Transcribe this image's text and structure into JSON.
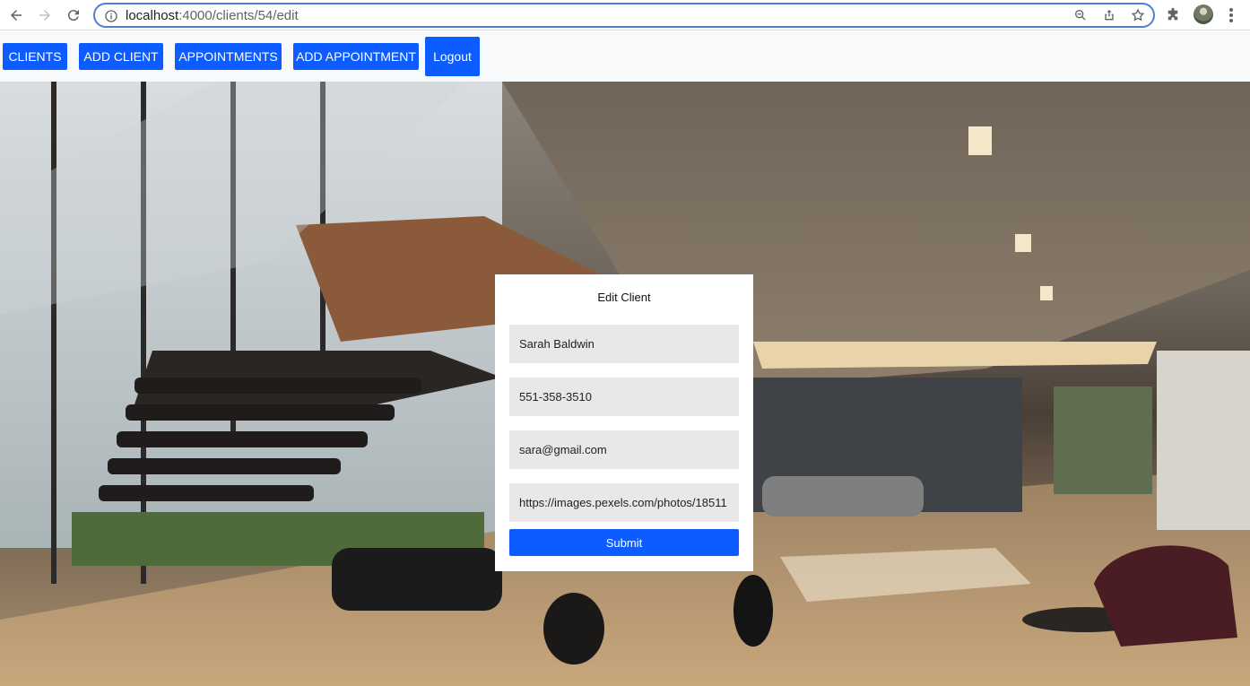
{
  "browser": {
    "url_host": "localhost",
    "url_path": ":4000/clients/54/edit"
  },
  "nav": {
    "clients": "CLIENTS",
    "add_client": "ADD CLIENT",
    "appointments": "APPOINTMENTS",
    "add_appointment": "ADD APPOINTMENT",
    "logout": "Logout"
  },
  "form": {
    "title": "Edit Client",
    "name_value": "Sarah Baldwin",
    "phone_value": "551-358-3510",
    "email_value": "sara@gmail.com",
    "image_value": "https://images.pexels.com/photos/18511",
    "submit_label": "Submit"
  },
  "colors": {
    "accent": "#0d5cff",
    "field_bg": "#e8e8e8"
  }
}
